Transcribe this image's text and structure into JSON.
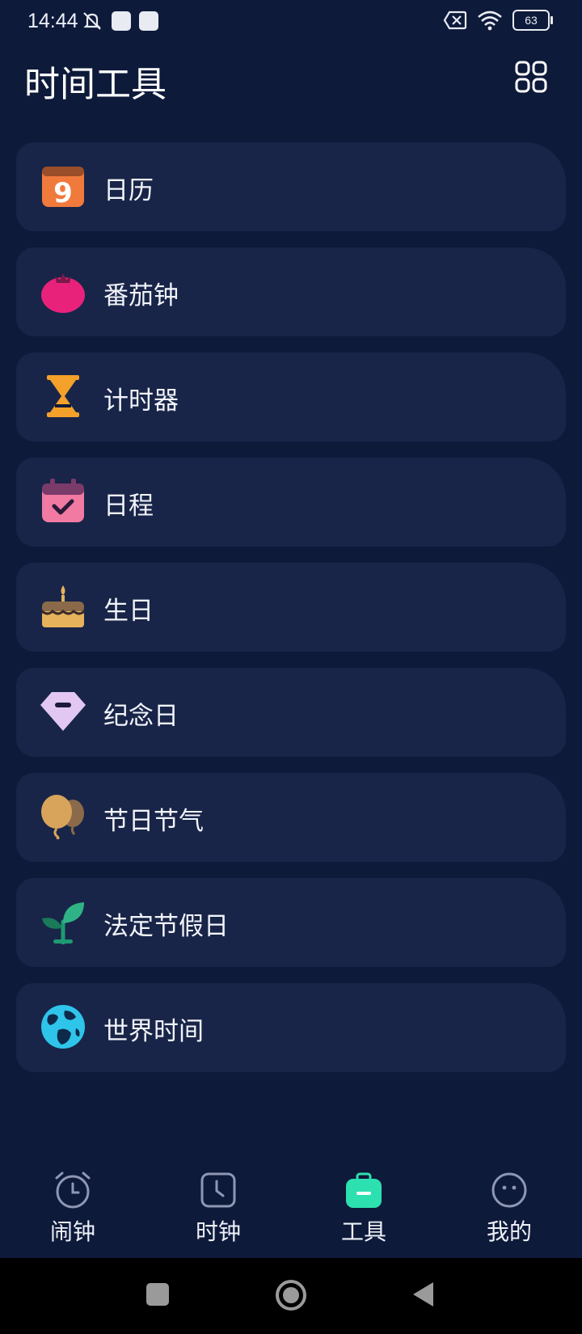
{
  "status_bar": {
    "time": "14:44",
    "battery": "63"
  },
  "header": {
    "title": "时间工具"
  },
  "tools": [
    {
      "label": "日历",
      "icon": "calendar-icon",
      "color": "#f07a3c"
    },
    {
      "label": "番茄钟",
      "icon": "tomato-icon",
      "color": "#e8227a"
    },
    {
      "label": "计时器",
      "icon": "hourglass-icon",
      "color": "#f3a12a"
    },
    {
      "label": "日程",
      "icon": "schedule-icon",
      "color": "#f07aa2"
    },
    {
      "label": "生日",
      "icon": "birthday-cake-icon",
      "color": "#e6b25c"
    },
    {
      "label": "纪念日",
      "icon": "diamond-icon",
      "color": "#e2c7f3"
    },
    {
      "label": "节日节气",
      "icon": "balloon-icon",
      "color": "#d8a45c"
    },
    {
      "label": "法定节假日",
      "icon": "sprout-icon",
      "color": "#27a27a"
    },
    {
      "label": "世界时间",
      "icon": "globe-icon",
      "color": "#2fc4ea"
    }
  ],
  "bottom_nav": [
    {
      "label": "闹钟",
      "icon": "alarm-clock-icon",
      "active": false
    },
    {
      "label": "时钟",
      "icon": "clock-icon",
      "active": false
    },
    {
      "label": "工具",
      "icon": "toolbox-icon",
      "active": true
    },
    {
      "label": "我的",
      "icon": "face-icon",
      "active": false
    }
  ],
  "colors": {
    "background": "#0e1a3a",
    "card": "#182548",
    "active_accent": "#2de0b0",
    "inactive_icon": "#8e98b4"
  }
}
